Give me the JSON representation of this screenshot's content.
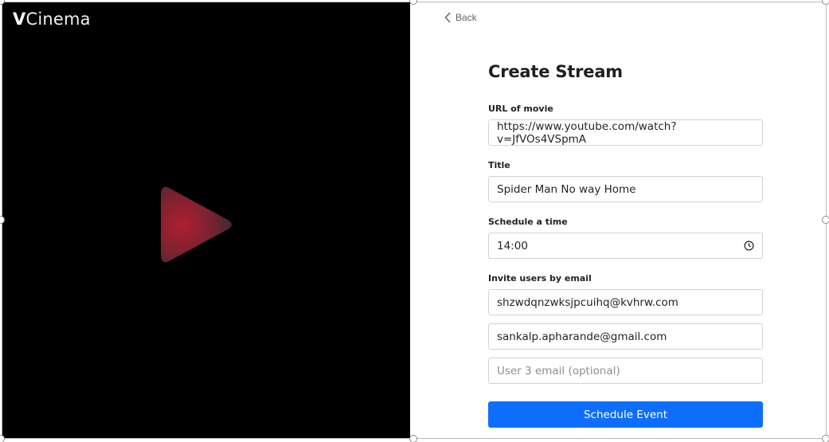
{
  "brand": {
    "logo_initial": "V",
    "logo_rest": "Cinema"
  },
  "nav": {
    "back_label": "Back"
  },
  "form": {
    "title": "Create Stream",
    "url_label": "URL of movie",
    "url_value": "https://www.youtube.com/watch?v=JfVOs4VSpmA",
    "title_label": "Title",
    "title_value": "Spider Man No way Home",
    "time_label": "Schedule a time",
    "time_value": "14:00",
    "invite_label": "Invite users by email",
    "emails": [
      "shzwdqnzwksjpcuihq@kvhrw.com",
      "sankalp.apharande@gmail.com"
    ],
    "email3_placeholder": "User 3 email (optional)",
    "submit_label": "Schedule Event"
  },
  "colors": {
    "accent": "#0d6efd",
    "left_panel": "#000000",
    "play_icon": "#8b2330"
  },
  "icons": {
    "back": "chevron-left-icon",
    "clock": "clock-icon",
    "play": "play-icon"
  }
}
